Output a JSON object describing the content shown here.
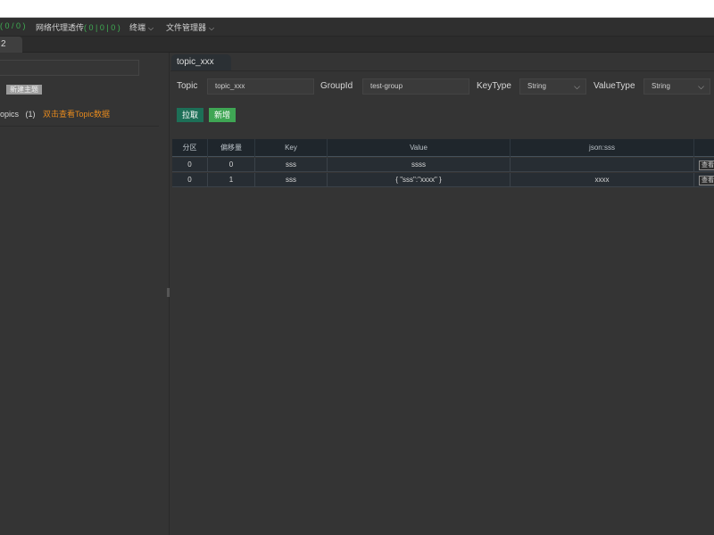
{
  "menubar": {
    "items": [
      {
        "label": "( 0 / 0 )",
        "count": true
      },
      {
        "label": "网络代理透传",
        "count_text": "( 0 | 0 | 0 )"
      },
      {
        "label": "终端",
        "dropdown": true
      },
      {
        "label": "文件管理器",
        "dropdown": true
      }
    ]
  },
  "top_tab": {
    "label": "2"
  },
  "sidebar": {
    "new_topic_button": "新建主题",
    "topics_label": "opics",
    "topics_count": "(1)",
    "topics_hint": "双击查看Topic数据"
  },
  "main": {
    "tab_label": "topic_xxx",
    "form": {
      "topic_label": "Topic",
      "topic_value": "topic_xxx",
      "group_label": "GroupId",
      "group_value": "test-group",
      "keytype_label": "KeyType",
      "keytype_value": "String",
      "valuetype_label": "ValueType",
      "valuetype_value": "String"
    },
    "buttons": {
      "fetch": "拉取",
      "add": "新增"
    },
    "table": {
      "headers": [
        "分区",
        "偏移量",
        "Key",
        "Value",
        "json:sss",
        ""
      ],
      "rows": [
        {
          "partition": "0",
          "offset": "0",
          "key": "sss",
          "value": "ssss",
          "json": "",
          "action": "查看"
        },
        {
          "partition": "0",
          "offset": "1",
          "key": "sss",
          "value": "{ \"sss\":\"xxxx\" }",
          "json": "xxxx",
          "action": "查看"
        }
      ]
    }
  }
}
